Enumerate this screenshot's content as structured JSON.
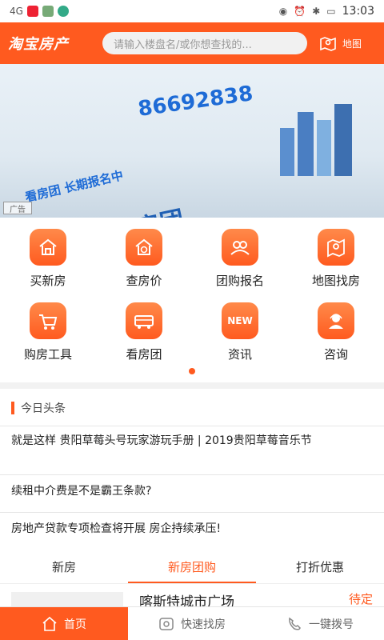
{
  "status_bar": {
    "time": "13:03",
    "left_text": "4G"
  },
  "header": {
    "logo": "淘宝房产",
    "search_placeholder": "请输入楼盘名/或你想查找的...",
    "map_label": "地图"
  },
  "banner": {
    "phone": "86692838",
    "tagline": "看房团 长期报名中",
    "big_text": "看房团",
    "corner_label": "广告"
  },
  "grid": [
    {
      "label": "买新房",
      "icon": "house-icon"
    },
    {
      "label": "查房价",
      "icon": "price-house-icon"
    },
    {
      "label": "团购报名",
      "icon": "group-icon"
    },
    {
      "label": "地图找房",
      "icon": "map-pin-icon"
    },
    {
      "label": "购房工具",
      "icon": "cart-icon"
    },
    {
      "label": "看房团",
      "icon": "bus-icon"
    },
    {
      "label": "资讯",
      "icon": "new-icon",
      "badge": "NEW"
    },
    {
      "label": "咨询",
      "icon": "consultant-icon"
    }
  ],
  "news": {
    "title": "今日头条",
    "items": [
      "就是这样 贵阳草莓头号玩家游玩手册 | 2019贵阳草莓音乐节",
      "续租中介费是不是霸王条款?",
      "房地产贷款专项检查将开展 房企持续承压!"
    ]
  },
  "tabs": [
    "新房",
    "新房团购",
    "打折优惠"
  ],
  "active_tab": 1,
  "listing": {
    "name": "喀斯特城市广场",
    "status": "待定"
  },
  "bottom_nav": [
    "首页",
    "快速找房",
    "一键拨号"
  ],
  "colors": {
    "accent": "#ff5a1f"
  }
}
